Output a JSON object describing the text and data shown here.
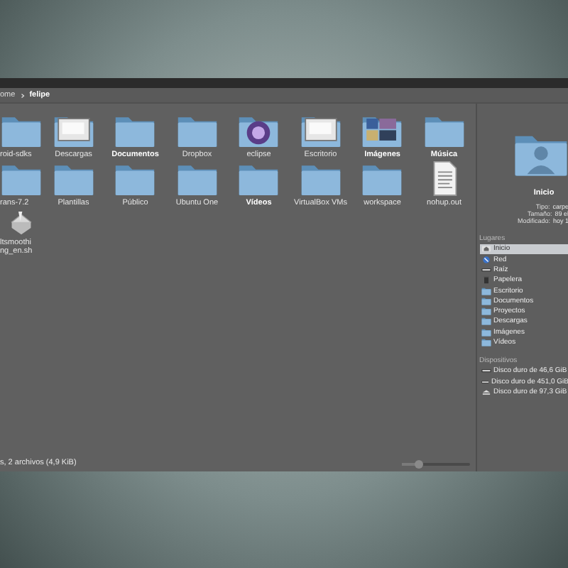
{
  "breadcrumb": [
    {
      "label": "ome",
      "selected": false
    },
    {
      "label": "felipe",
      "selected": true
    }
  ],
  "files": [
    {
      "label": "roid-sdks",
      "kind": "folder",
      "bold": false
    },
    {
      "label": "Descargas",
      "kind": "preview",
      "bold": false
    },
    {
      "label": "Documentos",
      "kind": "folder",
      "bold": true
    },
    {
      "label": "Dropbox",
      "kind": "folder",
      "bold": false
    },
    {
      "label": "eclipse",
      "kind": "emblem",
      "bold": false
    },
    {
      "label": "Escritorio",
      "kind": "preview",
      "bold": false
    },
    {
      "label": "Imágenes",
      "kind": "photos",
      "bold": true
    },
    {
      "label": "Música",
      "kind": "folder",
      "bold": true
    },
    {
      "label": "rans-7.2",
      "kind": "folder",
      "bold": false
    },
    {
      "label": "Plantillas",
      "kind": "folder",
      "bold": false
    },
    {
      "label": "Público",
      "kind": "folder",
      "bold": false
    },
    {
      "label": "Ubuntu One",
      "kind": "folder",
      "bold": false
    },
    {
      "label": "Vídeos",
      "kind": "folder",
      "bold": true
    },
    {
      "label": "VirtualBox VMs",
      "kind": "folder",
      "bold": false
    },
    {
      "label": "workspace",
      "kind": "folder",
      "bold": false
    },
    {
      "label": "nohup.out",
      "kind": "file",
      "bold": false
    },
    {
      "label": "ltsmoothing_en.sh",
      "kind": "script",
      "bold": false
    }
  ],
  "status_bar": {
    "text": "s, 2 archivos (4,9 KiB)",
    "zoom": {
      "level": 0.25
    }
  },
  "info": {
    "title": "Inicio",
    "rows": [
      {
        "label": "Tipo:",
        "value": "carpe"
      },
      {
        "label": "Tamaño:",
        "value": "89 el"
      },
      {
        "label": "Modificado:",
        "value": "hoy 1"
      }
    ]
  },
  "places": {
    "heading": "Lugares",
    "items": [
      {
        "label": "Inicio",
        "kind": "home",
        "selected": true
      },
      {
        "label": "Red",
        "kind": "network",
        "selected": false
      },
      {
        "label": "Raíz",
        "kind": "drive",
        "selected": false
      },
      {
        "label": "Papelera",
        "kind": "trash",
        "selected": false
      },
      {
        "label": "Escritorio",
        "kind": "folder",
        "selected": false
      },
      {
        "label": "Documentos",
        "kind": "folder",
        "selected": false
      },
      {
        "label": "Proyectos",
        "kind": "folder",
        "selected": false
      },
      {
        "label": "Descargas",
        "kind": "folder",
        "selected": false
      },
      {
        "label": "Imágenes",
        "kind": "folder",
        "selected": false
      },
      {
        "label": "Vídeos",
        "kind": "folder",
        "selected": false
      }
    ]
  },
  "devices": {
    "heading": "Dispositivos",
    "items": [
      {
        "label": "Disco duro de 46,6 GiB",
        "kind": "drive",
        "selected": false
      },
      {
        "label": "Disco duro de 451,0 GiB",
        "kind": "drive",
        "selected": false
      },
      {
        "label": "Disco duro de 97,3 GiB",
        "kind": "eject",
        "selected": false
      }
    ]
  }
}
